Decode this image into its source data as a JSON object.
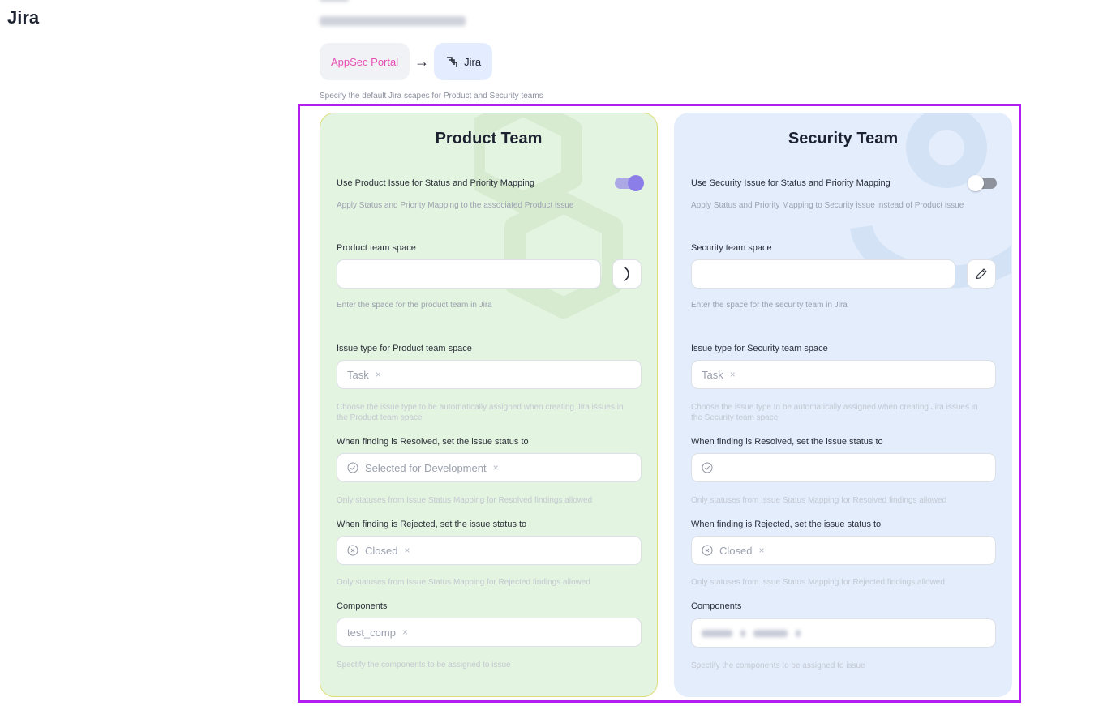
{
  "page": {
    "title": "Jira"
  },
  "flow": {
    "source": "AppSec Portal",
    "arrow": "→",
    "target": "Jira"
  },
  "subtitle": "Specify the default Jira scapes for Product and Security teams",
  "product": {
    "title": "Product Team",
    "toggle_label": "Use Product Issue for Status and Priority Mapping",
    "toggle_on": true,
    "toggle_hint": "Apply Status and Priority Mapping to the associated Product issue",
    "space_label": "Product team space",
    "space_value": "",
    "space_hint": "Enter the space for the product team in Jira",
    "issue_type_label": "Issue type for Product team space",
    "issue_type_value": "Task",
    "issue_type_hint": "Choose the issue type to be automatically assigned when creating Jira issues in the Product team space",
    "resolved_label": "When finding is Resolved, set the issue status to",
    "resolved_value": "Selected for Development",
    "resolved_hint": "Only statuses from Issue Status Mapping for Resolved findings allowed",
    "rejected_label": "When finding is Rejected, set the issue status to",
    "rejected_value": "Closed",
    "rejected_hint": "Only statuses from Issue Status Mapping for Rejected findings allowed",
    "components_label": "Components",
    "components_value": "test_comp",
    "components_hint": "Spectify the components to be assigned to issue"
  },
  "security": {
    "title": "Security Team",
    "toggle_label": "Use Security Issue for Status and Priority Mapping",
    "toggle_on": false,
    "toggle_hint": "Apply Status and Priority Mapping to Security issue instead of Product issue",
    "space_label": "Security team space",
    "space_value": "",
    "space_hint": "Enter the space for the security team in Jira",
    "issue_type_label": "Issue type for Security team space",
    "issue_type_value": "Task",
    "issue_type_hint": "Choose the issue type to be automatically assigned when creating Jira issues in the Security team space",
    "resolved_label": "When finding is Resolved, set the issue status to",
    "resolved_value": "",
    "resolved_hint": "Only statuses from Issue Status Mapping for Resolved findings allowed",
    "rejected_label": "When finding is Rejected, set the issue status to",
    "rejected_value": "Closed",
    "rejected_hint": "Only statuses from Issue Status Mapping for Rejected findings allowed",
    "components_label": "Components",
    "components_hint": "Spectify the components to be assigned to issue"
  },
  "icons": {
    "remove": "×",
    "loading": "loading-spinner-icon",
    "edit": "pencil-icon",
    "check": "check-circle-icon",
    "reject": "x-circle-icon",
    "jira": "jira-logo-icon"
  },
  "colors": {
    "frame": "#b21df0",
    "product_card": "#e3f4e0",
    "security_card": "#e3edfc",
    "toggle_on": "#8c7ee8",
    "portal_text": "#e64fb5"
  }
}
